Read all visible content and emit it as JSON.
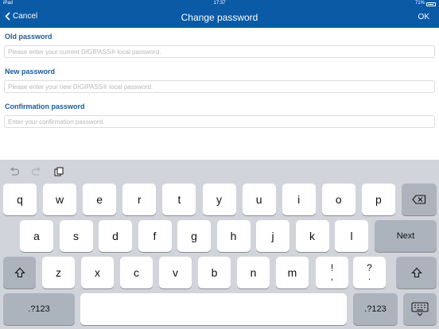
{
  "status": {
    "carrier": "iPad",
    "time": "17:37",
    "battery": "71%"
  },
  "nav": {
    "back_label": "Cancel",
    "title": "Change password",
    "ok_label": "OK"
  },
  "form": {
    "old": {
      "label": "Old password",
      "placeholder": "Please enter your current DIGIPASS® local password."
    },
    "new": {
      "label": "New password",
      "placeholder": "Please enter your new DIGIPASS® local password."
    },
    "confirm": {
      "label": "Confirmation password",
      "placeholder": "Enter your confirmation password."
    }
  },
  "keyboard": {
    "shortcuts": [
      "undo-icon",
      "redo-icon",
      "paste-icon"
    ],
    "row1": [
      "q",
      "w",
      "e",
      "r",
      "t",
      "y",
      "u",
      "i",
      "o",
      "p"
    ],
    "row2": [
      "a",
      "s",
      "d",
      "f",
      "g",
      "h",
      "j",
      "k",
      "l"
    ],
    "row2_action": "Next",
    "row3": [
      "z",
      "x",
      "c",
      "v",
      "b",
      "n",
      "m"
    ],
    "row3_punct": [
      {
        "top": "!",
        "bottom": ","
      },
      {
        "top": "?",
        "bottom": "."
      }
    ],
    "numbers_label": ".?123",
    "icons": {
      "backspace": "backspace-icon",
      "shift": "shift-icon",
      "hide_keyboard": "keyboard-hide-icon"
    }
  },
  "colors": {
    "nav_bg": "#0a5aa6",
    "label_text": "#1a5a9a",
    "keyboard_bg": "#d1d4da",
    "dark_key": "#adb3bd"
  }
}
